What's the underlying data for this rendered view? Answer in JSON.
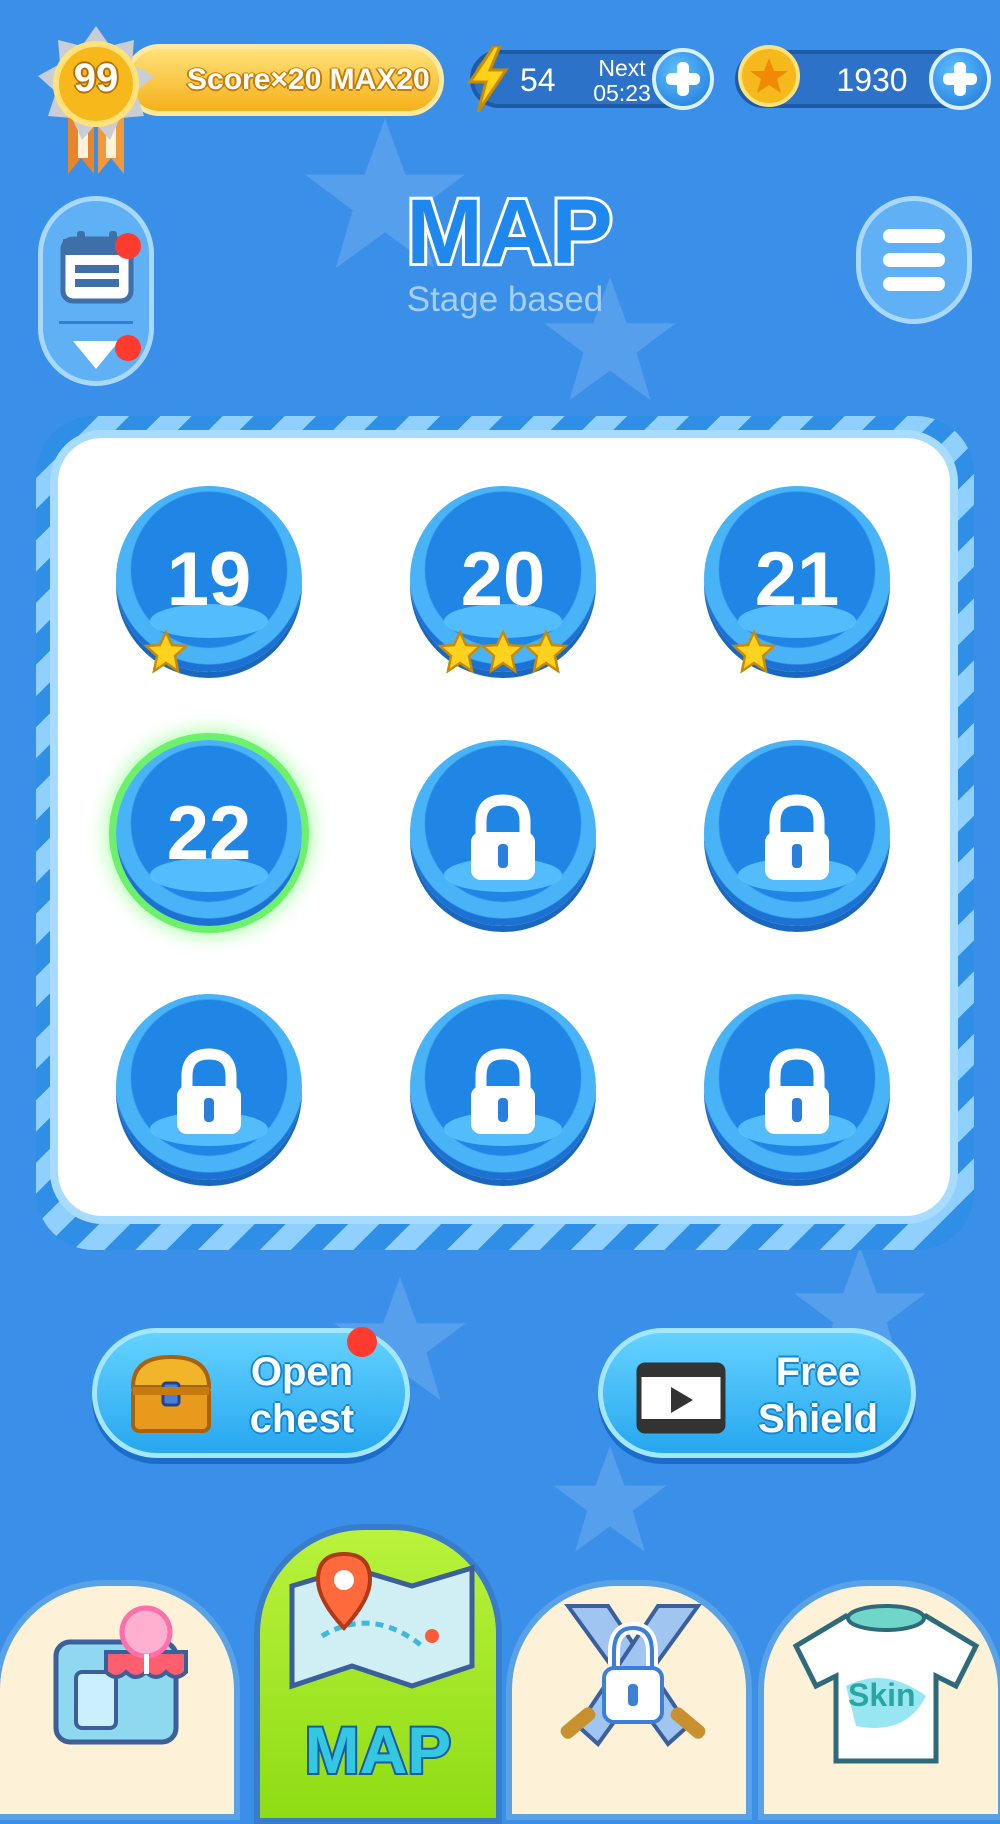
{
  "player": {
    "level": "99",
    "score_bonus": "Score×20 MAX20"
  },
  "resources": {
    "energy": "54",
    "next_label": "Next",
    "next_timer": "05:23",
    "coins": "1930"
  },
  "header": {
    "title": "MAP",
    "subtitle": "Stage based"
  },
  "stages": [
    {
      "number": "19",
      "stars": 1,
      "locked": false,
      "current": false
    },
    {
      "number": "20",
      "stars": 3,
      "locked": false,
      "current": false
    },
    {
      "number": "21",
      "stars": 1,
      "locked": false,
      "current": false
    },
    {
      "number": "22",
      "stars": 0,
      "locked": false,
      "current": true
    },
    {
      "number": "",
      "stars": 0,
      "locked": true,
      "current": false
    },
    {
      "number": "",
      "stars": 0,
      "locked": true,
      "current": false
    },
    {
      "number": "",
      "stars": 0,
      "locked": true,
      "current": false
    },
    {
      "number": "",
      "stars": 0,
      "locked": true,
      "current": false
    },
    {
      "number": "",
      "stars": 0,
      "locked": true,
      "current": false
    }
  ],
  "actions": {
    "open_chest_line1": "Open",
    "open_chest_line2": "chest",
    "free_shield_line1": "Free",
    "free_shield_line2": "Shield"
  },
  "nav": {
    "tabs": [
      {
        "icon": "candy-shop-icon",
        "label": ""
      },
      {
        "icon": "map-icon",
        "label": "MAP",
        "active": true
      },
      {
        "icon": "locked-swords-icon",
        "label": ""
      },
      {
        "icon": "skin-shirt-icon",
        "label": "Skin"
      }
    ]
  },
  "colors": {
    "background": "#3a8fe8",
    "active_tab": "#a3e626",
    "notification": "#ff3b2f"
  }
}
